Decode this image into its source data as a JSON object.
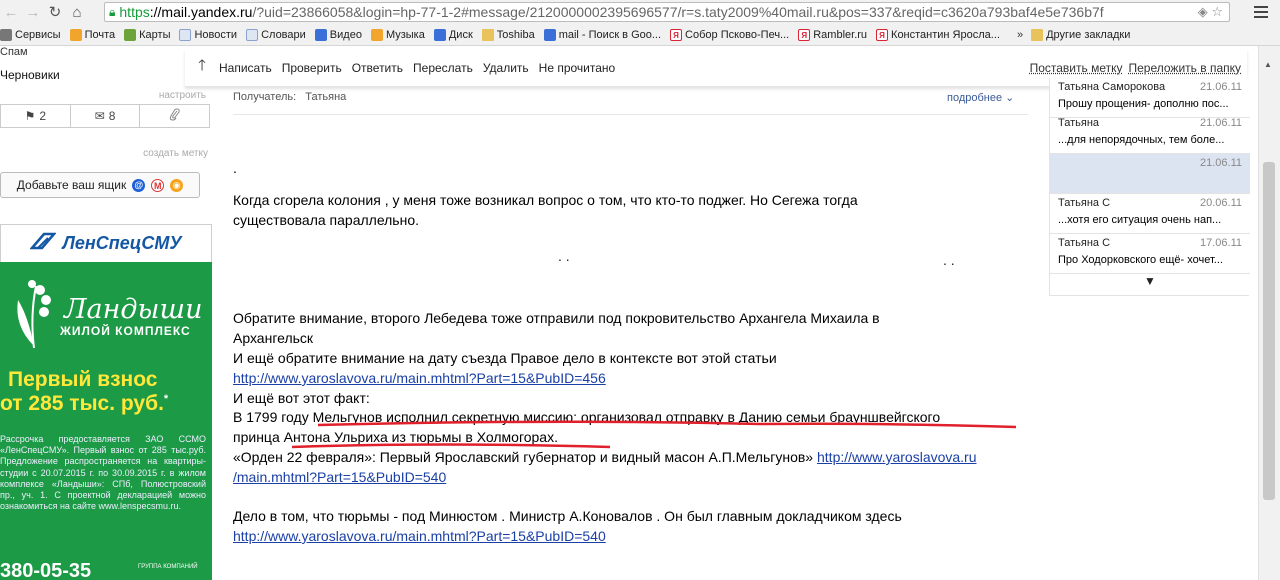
{
  "browser": {
    "url_https": "https",
    "url_host": "://mail.yandex.ru",
    "url_rest": "/?uid=23866058&login=hp-77-1-2#message/2120000002395696577/r=s.taty2009%40mail.ru&pos=337&reqid=c3620a793baf4e5e736b7f",
    "bookmarks": [
      {
        "label": "Сервисы",
        "icon": "grid-icon",
        "style": "grey"
      },
      {
        "label": "Почта",
        "icon": "mail-icon",
        "style": "orange"
      },
      {
        "label": "Карты",
        "icon": "maps-icon",
        "style": "green"
      },
      {
        "label": "Новости",
        "icon": "page-icon",
        "style": "page"
      },
      {
        "label": "Словари",
        "icon": "page-icon",
        "style": "page"
      },
      {
        "label": "Видео",
        "icon": "video-icon",
        "style": "blue"
      },
      {
        "label": "Музыка",
        "icon": "music-icon",
        "style": "orange"
      },
      {
        "label": "Диск",
        "icon": "disk-icon",
        "style": "blue"
      },
      {
        "label": "Toshiba",
        "icon": "folder-icon",
        "style": "folder"
      },
      {
        "label": "mail - Поиск в Goo...",
        "icon": "google-icon",
        "style": "blue"
      },
      {
        "label": "Собор Псково-Печ...",
        "icon": "yandex-icon",
        "style": "red"
      },
      {
        "label": "Rambler.ru",
        "icon": "yandex-icon",
        "style": "red"
      },
      {
        "label": "Константин Яросла...",
        "icon": "yandex-icon",
        "style": "red"
      }
    ],
    "more": "»",
    "other_bookmarks": "Другие закладки"
  },
  "sidebar": {
    "spam": "Спам",
    "drafts": "Черновики",
    "configure": "настроить",
    "counters": [
      {
        "icon": "flag-icon",
        "glyph": "⚑",
        "value": "2"
      },
      {
        "icon": "envelope-icon",
        "glyph": "✉",
        "value": "8"
      },
      {
        "icon": "paperclip-icon",
        "glyph": "⌕",
        "value": ""
      }
    ],
    "create_tag": "создать метку",
    "add_mailbox": "Добавьте ваш ящик"
  },
  "ad": {
    "company": "ЛенСпецСМУ",
    "brand": "Ландыши",
    "brand_sub": "ЖИЛОЙ КОМПЛЕКС",
    "offer_line1": "Первый взнос",
    "offer_line2": "от 285 тыс. руб.",
    "offer_mark": "*",
    "fine_print": "Рассрочка предоставляется ЗАО ССМО «ЛенСпецСМУ». Первый взнос от 285 тыс.руб. Предложение распространяется на квартиры-студии с 20.07.2015 г. по 30.09.2015 г. в жилом комплексе «Ландыши»: СПб, Полюстровский пр., уч. 1. С проектной декларацией можно ознакомиться на сайте www.lenspecsmu.ru.",
    "phone": "380-05-35",
    "group": "ГРУППА КОМПАНИЙ"
  },
  "toolbar": {
    "write": "Написать",
    "check": "Проверить",
    "reply": "Ответить",
    "forward": "Переслать",
    "delete": "Удалить",
    "unread": "Не прочитано",
    "set_tag": "Поставить метку",
    "move_folder": "Переложить в папку"
  },
  "message": {
    "recipient_label": "Получатель:",
    "recipient_name": "Татьяна",
    "more": "подробнее",
    "lines": [
      {
        "text": ".",
        "kind": "text"
      },
      {
        "text": " Когда сгорела  колония ,  у меня тоже возникал вопрос о том, что  кто-то  поджег. Но Сегежа тогда",
        "kind": "text"
      },
      {
        "text": "существовала  параллельно.",
        "kind": "text"
      },
      {
        "text": " Обратите внимание, второго  Лебедева  тоже отправили под   покровительство  Архангела Михаила в",
        "kind": "text"
      },
      {
        "text": "Архангельск",
        "kind": "text"
      },
      {
        "text": "  И ещё  обратите  внимание  на  дату       съезда Правое дело в  контексте вот этой   статьи",
        "kind": "text"
      },
      {
        "text": "http://www.yaroslavova.ru/main.mhtml?Part=15&PubID=456",
        "kind": "link"
      },
      {
        "text": "  И ещё  вот этот  факт:",
        "kind": "text"
      },
      {
        "text": "В 1799 году Мельгунов исполнил секретную миссию: организовал отправку в Данию семьи брауншвейгского",
        "kind": "text"
      },
      {
        "text": "принца Антона Ульриха из тюрьмы в Холмогорах.",
        "kind": "text"
      },
      {
        "text": "«Орден 22 февраля»: Первый Ярославский губернатор и видный масон А.П.Мельгунов» ",
        "kind": "mixed",
        "link": "http://www.yaroslavova.ru"
      },
      {
        "text": "/main.mhtml?Part=15&PubID=540",
        "kind": "link"
      },
      {
        "text": " Дело в том, что тюрьмы -  под Минюстом . Министр А.Коновалов .  Он был  главным докладчиком здесь",
        "kind": "text"
      },
      {
        "text": "http://www.yaroslavova.ru/main.mhtml?Part=15&PubID=540",
        "kind": "link"
      }
    ]
  },
  "threads": [
    {
      "sender": "Татьяна Саморокова",
      "date": "21.06.11",
      "snippet": "Прошу прощения- дополню пос...",
      "active": false
    },
    {
      "sender": "Татьяна",
      "date": "21.06.11",
      "snippet": "...для непорядочных, тем боле...",
      "active": false
    },
    {
      "sender": "",
      "date": "21.06.11",
      "snippet": "",
      "active": true
    },
    {
      "sender": "Татьяна С",
      "date": "20.06.11",
      "snippet": "...хотя его ситуация очень нап...",
      "active": false
    },
    {
      "sender": "Татьяна С",
      "date": "17.06.11",
      "snippet": "Про Ходорковского ещё- хочет...",
      "active": false
    }
  ],
  "colors": {
    "ad_green": "#1c9a46",
    "ad_yellow": "#ffe83a",
    "link": "#1a3fa6",
    "underline_red": "#e0202a"
  }
}
